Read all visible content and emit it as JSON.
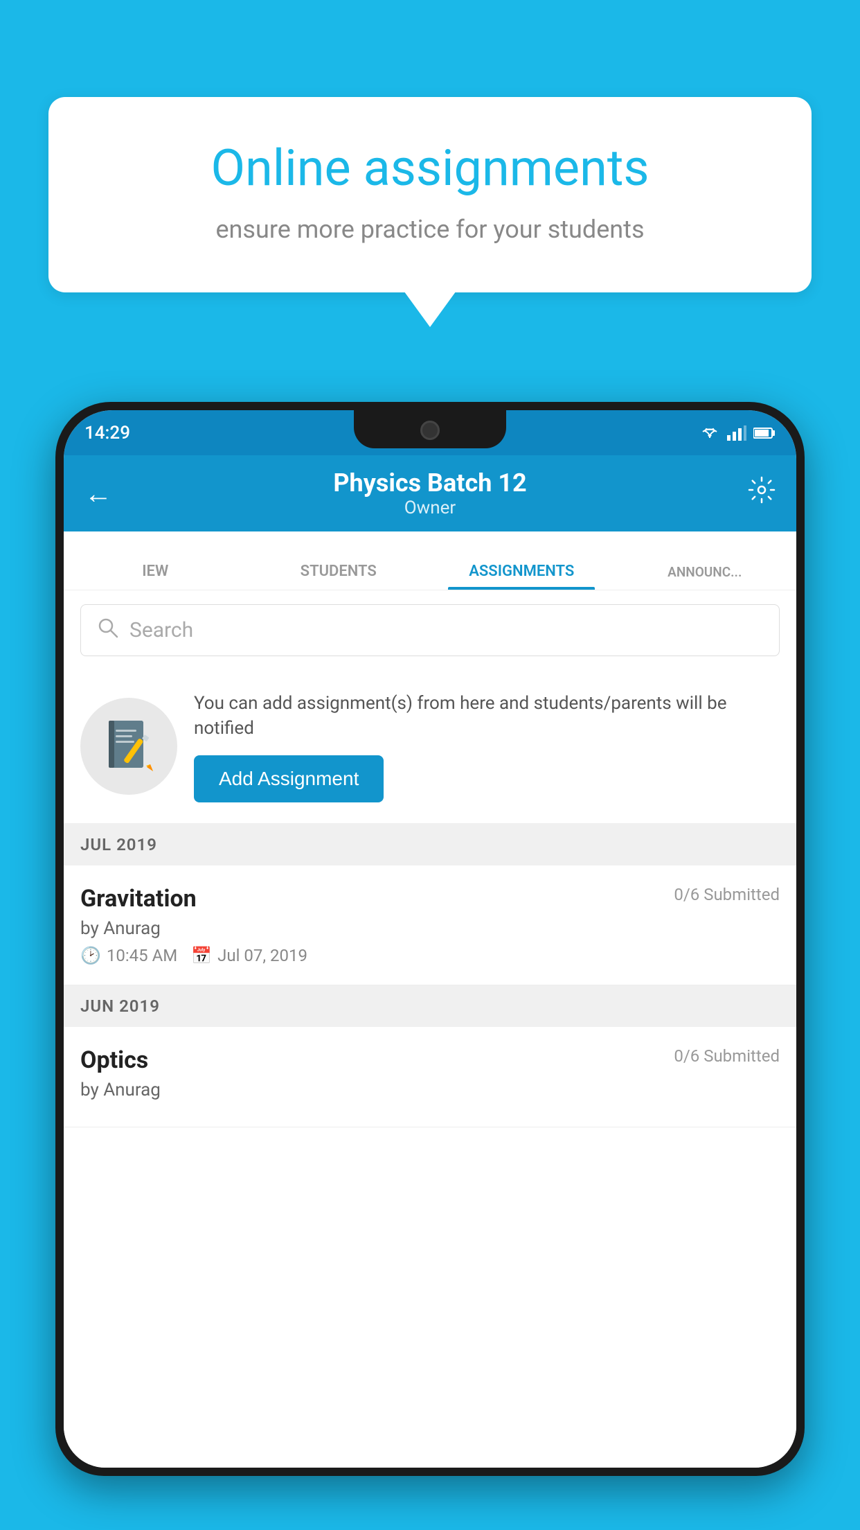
{
  "background_color": "#1BB8E8",
  "speech_bubble": {
    "title": "Online assignments",
    "subtitle": "ensure more practice for your students"
  },
  "phone": {
    "status_bar": {
      "time": "14:29"
    },
    "header": {
      "title": "Physics Batch 12",
      "subtitle": "Owner",
      "back_label": "←",
      "settings_label": "⚙"
    },
    "tabs": [
      {
        "label": "IEW",
        "active": false
      },
      {
        "label": "STUDENTS",
        "active": false
      },
      {
        "label": "ASSIGNMENTS",
        "active": true
      },
      {
        "label": "ANNOUNCEM...",
        "active": false
      }
    ],
    "search": {
      "placeholder": "Search"
    },
    "info_card": {
      "description": "You can add assignment(s) from here and students/parents will be notified",
      "button_label": "Add Assignment"
    },
    "sections": [
      {
        "label": "JUL 2019",
        "assignments": [
          {
            "name": "Gravitation",
            "submitted": "0/6 Submitted",
            "by": "by Anurag",
            "time": "10:45 AM",
            "date": "Jul 07, 2019"
          }
        ]
      },
      {
        "label": "JUN 2019",
        "assignments": [
          {
            "name": "Optics",
            "submitted": "0/6 Submitted",
            "by": "by Anurag",
            "time": "",
            "date": ""
          }
        ]
      }
    ]
  }
}
